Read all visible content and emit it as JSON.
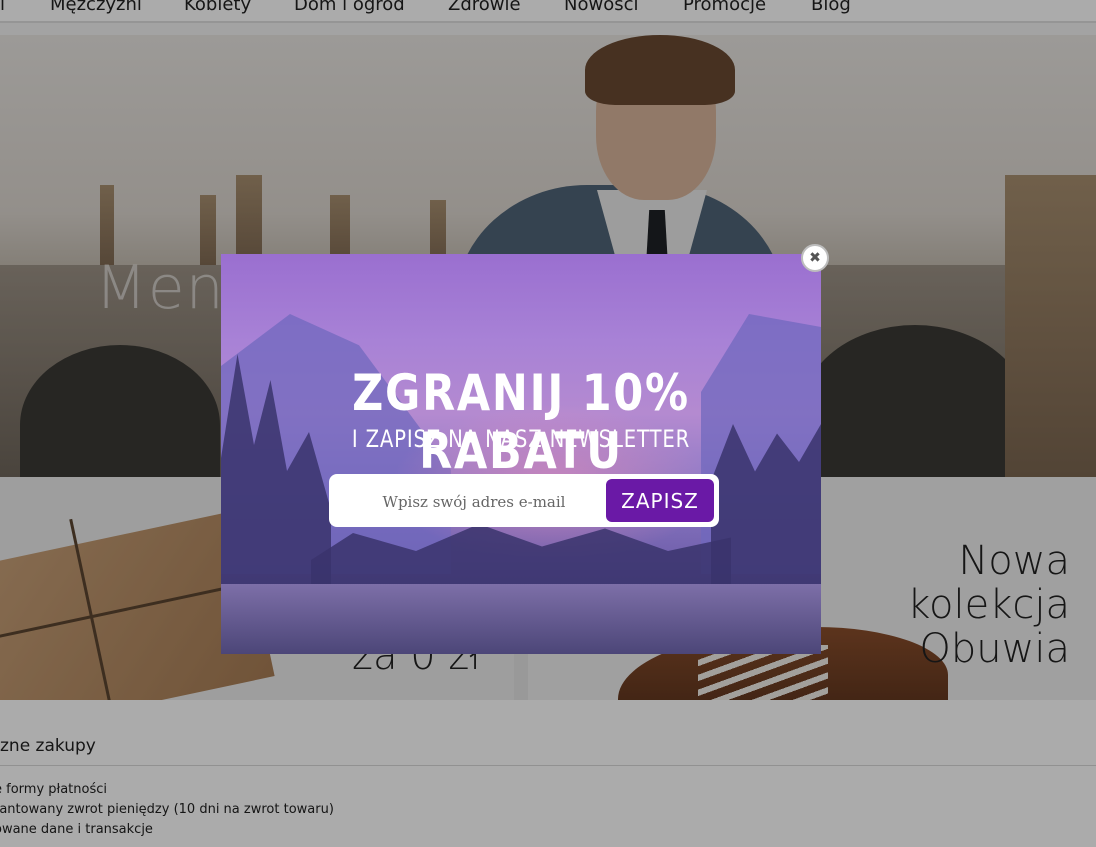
{
  "nav": {
    "items": [
      "Mężczyźni",
      "Kobiety",
      "Dom i ogród",
      "Zdrowie",
      "Nowości",
      "Promocje",
      "Blog"
    ]
  },
  "hero": {
    "text": "Men"
  },
  "promos": {
    "left_text": "za 0 zł",
    "right_title": [
      "Nowa",
      "kolekcja",
      "Obuwia"
    ]
  },
  "benefits": {
    "heading": "zne zakupy",
    "items": [
      "e formy płatności",
      "rantowany zwrot pieniędzy (10 dni na zwrot towaru)",
      "owane dane i transakcje"
    ]
  },
  "popup": {
    "title": "ZGRANIJ 10% RABATU",
    "subtitle": "I ZAPISZ NA NASZ NEWSLETTER",
    "email_placeholder": "Wpisz swój adres e-mail",
    "submit_label": "ZAPISZ",
    "close_symbol": "✖",
    "accent_color": "#6a19a6"
  }
}
